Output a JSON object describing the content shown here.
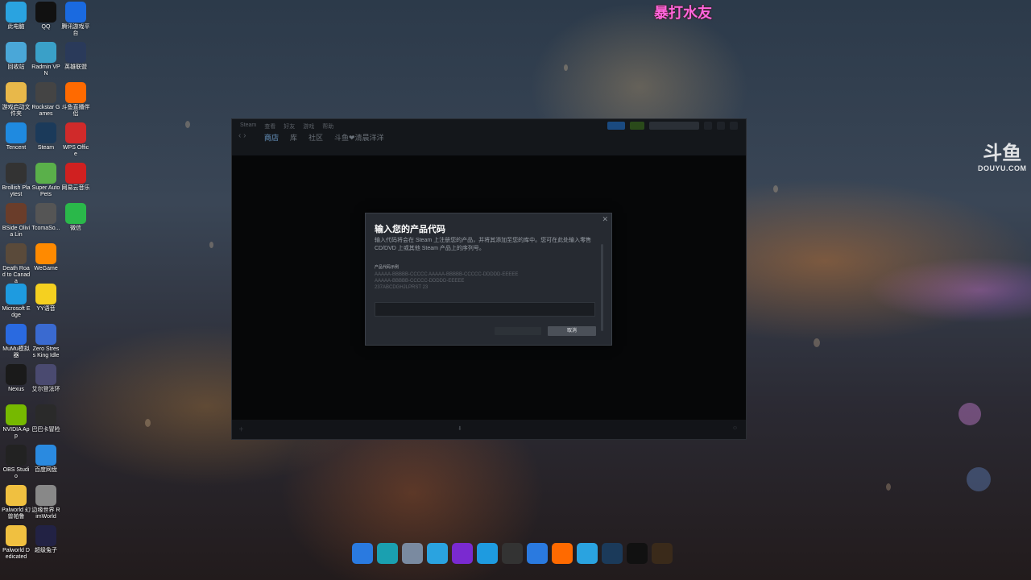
{
  "overlay": {
    "stream_title": "暴打水友",
    "watermark_logo": "斗鱼",
    "watermark_text": "DOUYU.COM"
  },
  "desktop": {
    "icons": [
      {
        "label": "此电脑",
        "icon": "computer-icon",
        "color": "#2aa3e0"
      },
      {
        "label": "回收站",
        "icon": "recycle-bin-icon",
        "color": "#4aa7d8"
      },
      {
        "label": "游戏启动文件夹",
        "icon": "folder-icon",
        "color": "#e8b84a"
      },
      {
        "label": "Tencent",
        "icon": "tencent-icon",
        "color": "#1f8ae0"
      },
      {
        "label": "Brollish Playtest",
        "icon": "game-icon",
        "color": "#333"
      },
      {
        "label": "BSide Olivia Lin",
        "icon": "game-icon",
        "color": "#6a3d2a"
      },
      {
        "label": "Death Road to Canada",
        "icon": "game-icon",
        "color": "#5a4a3a"
      },
      {
        "label": "Microsoft Edge",
        "icon": "edge-icon",
        "color": "#1e9be0"
      },
      {
        "label": "MuMu模拟器",
        "icon": "mumu-icon",
        "color": "#2a6ae0"
      },
      {
        "label": "Nexus",
        "icon": "nexus-icon",
        "color": "#1a1a1a"
      },
      {
        "label": "NVIDIA App",
        "icon": "nvidia-icon",
        "color": "#76b900"
      },
      {
        "label": "OBS Studio",
        "icon": "obs-icon",
        "color": "#222"
      },
      {
        "label": "Palworld 幻兽帕鲁",
        "icon": "palworld-icon",
        "color": "#f0c040"
      },
      {
        "label": "Palworld Dedicated",
        "icon": "palworld-icon",
        "color": "#f0c040"
      },
      {
        "label": "QQ",
        "icon": "qq-icon",
        "color": "#111"
      },
      {
        "label": "Radmin VPN",
        "icon": "vpn-icon",
        "color": "#3aa0c8"
      },
      {
        "label": "Rockstar Games",
        "icon": "game-icon",
        "color": "#444"
      },
      {
        "label": "Steam",
        "icon": "steam-icon",
        "color": "#1b3a5a"
      },
      {
        "label": "Super Auto Pets",
        "icon": "game-icon",
        "color": "#5ab04a"
      },
      {
        "label": "TcomaSo...",
        "icon": "game-icon",
        "color": "#555"
      },
      {
        "label": "WeGame",
        "icon": "wegame-icon",
        "color": "#ff8a00"
      },
      {
        "label": "YY语音",
        "icon": "yy-icon",
        "color": "#f5d020"
      },
      {
        "label": "Zero Stress King Idle",
        "icon": "game-icon",
        "color": "#3a6ad0"
      },
      {
        "label": "艾尔登法环",
        "icon": "game-icon",
        "color": "#4a4a70"
      },
      {
        "label": "巴巴卡冒险",
        "icon": "game-icon",
        "color": "#2a2a2a"
      },
      {
        "label": "百度网盘",
        "icon": "baidu-icon",
        "color": "#2a8ae0"
      },
      {
        "label": "边缘世界 RimWorld",
        "icon": "game-icon",
        "color": "#888"
      },
      {
        "label": "超级兔子",
        "icon": "game-icon",
        "color": "#224"
      },
      {
        "label": "腾讯游戏平台",
        "icon": "game-icon",
        "color": "#1a6ae0"
      },
      {
        "label": "英雄联盟",
        "icon": "game-icon",
        "color": "#2a3a5a"
      },
      {
        "label": "斗鱼直播伴侣",
        "icon": "douyu-icon",
        "color": "#ff6a00"
      },
      {
        "label": "WPS Office",
        "icon": "wps-icon",
        "color": "#d02a2a"
      },
      {
        "label": "网易云音乐",
        "icon": "netease-music-icon",
        "color": "#d02020"
      },
      {
        "label": "微信",
        "icon": "wechat-icon",
        "color": "#2ab84a"
      }
    ]
  },
  "steam": {
    "nav": [
      "商店",
      "库",
      "社区",
      "斗鱼❤清晨洋洋"
    ],
    "menu": [
      "Steam",
      "查看",
      "好友",
      "游戏",
      "帮助"
    ]
  },
  "modal": {
    "title": "输入您的产品代码",
    "description": "输入代码将会在 Steam 上注册您的产品，并将其添加至您的库中。您可在此处输入零售 CD/DVD 上或其他 Steam 产品上的序列号。",
    "examples_label": "产品代码示例",
    "examples": [
      "AAAAA-BBBBB-CCCCC AAAAA-BBBBB-CCCCC-DDDDD-EEEEE",
      "AAAAA-BBBBB-CCCCC-DDDDD-EEEEE",
      "237ABCDGHJLPRST 23"
    ],
    "input_value": "",
    "ok_label": "",
    "cancel_label": "取消"
  },
  "taskbar": [
    {
      "icon": "windows-start-icon",
      "color": "#2a7ae0"
    },
    {
      "icon": "circle-app-icon",
      "color": "#1aa0b0"
    },
    {
      "icon": "bag-icon",
      "color": "#7a8aa0"
    },
    {
      "icon": "monitor-icon",
      "color": "#2aa3e0"
    },
    {
      "icon": "purple-app-icon",
      "color": "#7a2ad0"
    },
    {
      "icon": "edge-icon",
      "color": "#1e9be0"
    },
    {
      "icon": "obs-icon",
      "color": "#333"
    },
    {
      "icon": "blue-app-icon",
      "color": "#2a7ae0"
    },
    {
      "icon": "douyu-icon",
      "color": "#ff6a00"
    },
    {
      "icon": "steam-s-icon",
      "color": "#2aa3e0"
    },
    {
      "icon": "steam-icon",
      "color": "#1b3a5a"
    },
    {
      "icon": "qq-icon",
      "color": "#111"
    },
    {
      "icon": "game-icon",
      "color": "#3a2a1a"
    }
  ]
}
